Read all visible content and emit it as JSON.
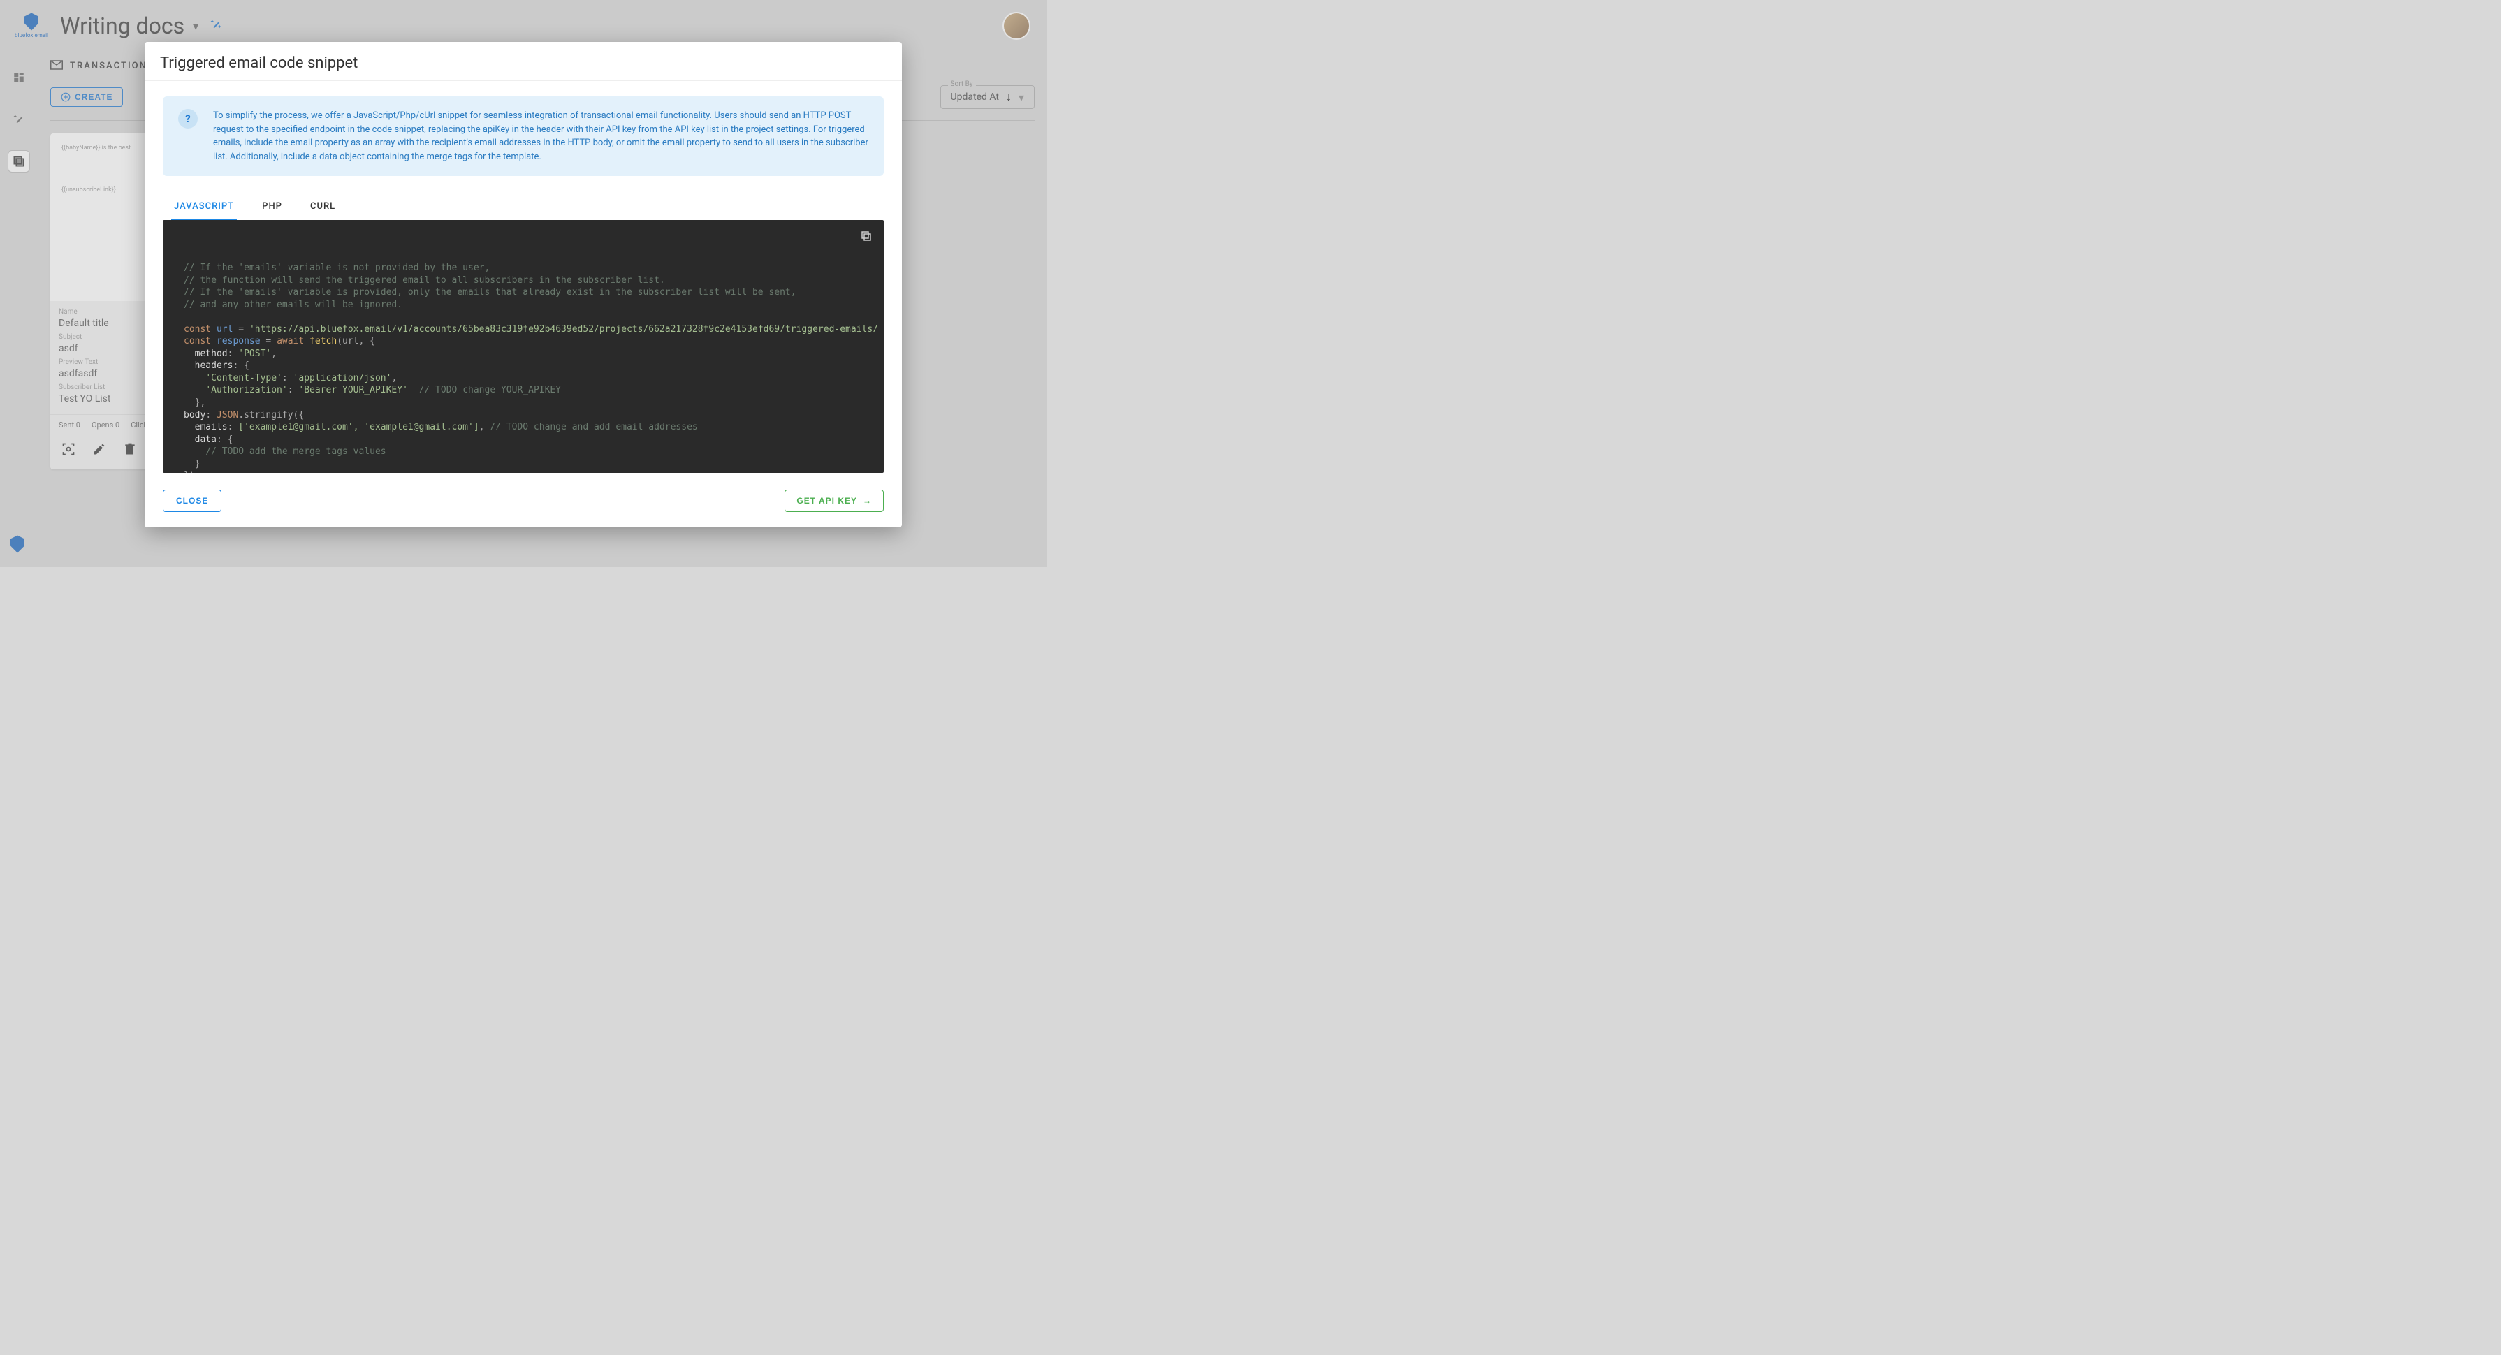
{
  "header": {
    "logo_text": "bluefox.email",
    "page_title": "Writing docs"
  },
  "section": {
    "title": "TRANSACTIONAL",
    "create_label": "CREATE"
  },
  "sort": {
    "label": "Sort By",
    "value": "Updated At"
  },
  "card": {
    "preview_line1": "{{babyName}} is the best",
    "preview_line2": "{{unsubscribeLink}}",
    "name_label": "Name",
    "name_value": "Default title",
    "subject_label": "Subject",
    "subject_value": "asdf",
    "preview_label": "Preview Text",
    "preview_value": "asdfasdf",
    "list_label": "Subscriber List",
    "list_value": "Test YO List",
    "sent": "Sent 0",
    "opens": "Opens 0",
    "clicks": "Clicks"
  },
  "modal": {
    "title": "Triggered email code snippet",
    "info_text": "To simplify the process, we offer a JavaScript/Php/cUrl snippet for seamless integration of transactional email functionality. Users should send an HTTP POST request to the specified endpoint in the code snippet, replacing the apiKey in the header with their API key from the API key list in the project settings. For triggered emails, include the email property as an array with the recipient's email addresses in the HTTP body, or omit the email property to send to all users in the subscriber list. Additionally, include a data object containing the merge tags for the template.",
    "tabs": {
      "js": "JAVASCRIPT",
      "php": "PHP",
      "curl": "CURL"
    },
    "close_label": "CLOSE",
    "key_label": "GET API KEY"
  },
  "code": {
    "c1": "// If the 'emails' variable is not provided by the user,",
    "c2": "// the function will send the triggered email to all subscribers in the subscriber list.",
    "c3": "// If the 'emails' variable is provided, only the emails that already exist in the subscriber list will be sent,",
    "c4": "// and any other emails will be ignored.",
    "const": "const",
    "url_var": "url",
    "eq": " = ",
    "url_str": "'https://api.bluefox.email/v1/accounts/65bea83c319fe92b4639ed52/projects/662a217328f9c2e4153efd69/triggered-emails/",
    "resp_var": "response",
    "await": "await",
    "fetch": "fetch",
    "fetch_args": "(url, {",
    "method_k": "method",
    "method_v": "'POST'",
    "headers_k": "headers",
    "ct_k": "'Content-Type'",
    "ct_v": "'application/json'",
    "auth_k": "'Authorization'",
    "auth_v": "'Bearer YOUR_APIKEY'",
    "auth_c": "// TODO change YOUR_APIKEY",
    "body_k": "body",
    "json": "JSON",
    "stringify": ".stringify({",
    "emails_k": "emails",
    "emails_v": "['example1@gmail.com', 'example1@gmail.com']",
    "emails_c": "// TODO change and add email addresses",
    "data_k": "data",
    "data_c": "// TODO add the merge tags values",
    "brace": "}",
    "brace_paren": "})",
    "colon_brace": ": {",
    "comma": ",",
    "close_brace_comma": "},"
  }
}
